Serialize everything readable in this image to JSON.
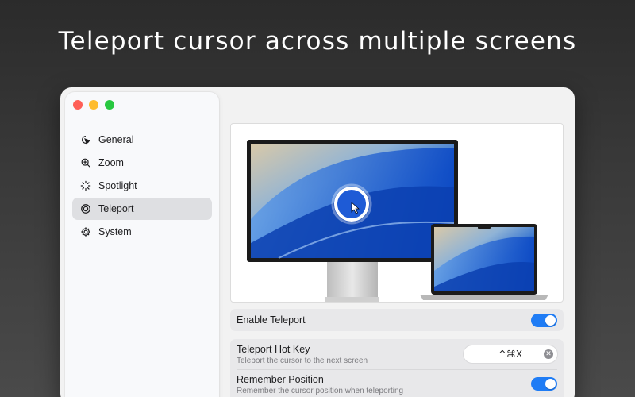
{
  "headline": "Teleport cursor across multiple screens",
  "window": {
    "traffic_lights": {
      "close": "#fe5f57",
      "minimize": "#febc2e",
      "zoom": "#28c840"
    }
  },
  "sidebar": {
    "items": [
      {
        "label": "General",
        "icon": "cursor-icon",
        "active": false
      },
      {
        "label": "Zoom",
        "icon": "magnifier-plus-icon",
        "active": false
      },
      {
        "label": "Spotlight",
        "icon": "spotlight-rays-icon",
        "active": false
      },
      {
        "label": "Teleport",
        "icon": "target-circle-icon",
        "active": true
      },
      {
        "label": "System",
        "icon": "gear-icon",
        "active": false
      }
    ]
  },
  "settings": {
    "enable": {
      "label": "Enable Teleport",
      "toggle_on": true
    },
    "hotkey": {
      "label": "Teleport Hot Key",
      "description": "Teleport the cursor to the next screen",
      "value": "^⌘X"
    },
    "remember": {
      "label": "Remember Position",
      "description": "Remember the cursor position when teleporting",
      "toggle_on": true
    }
  },
  "colors": {
    "accent": "#1f7cf5",
    "active_nav": "#dedfe2"
  }
}
